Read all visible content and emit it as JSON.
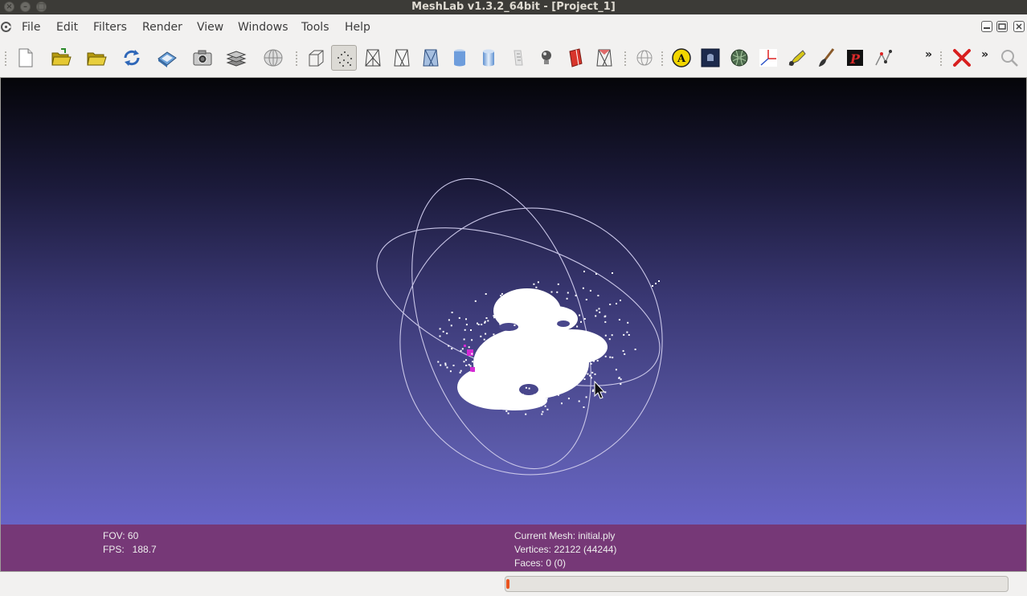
{
  "window": {
    "title": "MeshLab v1.3.2_64bit - [Project_1]"
  },
  "menubar": {
    "items": [
      {
        "label": "File"
      },
      {
        "label": "Edit"
      },
      {
        "label": "Filters"
      },
      {
        "label": "Render"
      },
      {
        "label": "View"
      },
      {
        "label": "Windows"
      },
      {
        "label": "Tools"
      },
      {
        "label": "Help"
      }
    ]
  },
  "toolbar": {
    "buttons": [
      {
        "icon": "new-document-icon"
      },
      {
        "icon": "open-project-icon"
      },
      {
        "icon": "import-mesh-icon"
      },
      {
        "icon": "reload-icon"
      },
      {
        "icon": "save-snapshot-icon"
      },
      {
        "icon": "camera-icon"
      },
      {
        "icon": "layers-icon"
      },
      {
        "icon": "raster-icon"
      },
      {
        "icon": "bounding-box-icon"
      },
      {
        "icon": "points-icon",
        "active": true
      },
      {
        "icon": "wireframe-icon"
      },
      {
        "icon": "hidden-lines-icon"
      },
      {
        "icon": "flat-lines-icon"
      },
      {
        "icon": "flat-shading-icon"
      },
      {
        "icon": "smooth-shading-icon"
      },
      {
        "icon": "texture-icon"
      },
      {
        "icon": "light-icon"
      },
      {
        "icon": "backface-icon"
      },
      {
        "icon": "selected-faces-icon"
      },
      {
        "icon": "trackball-icon"
      },
      {
        "icon": "annotation-icon"
      },
      {
        "icon": "raster-layer-icon"
      },
      {
        "icon": "texture-map-icon"
      },
      {
        "icon": "measure-icon"
      },
      {
        "icon": "pick-points-icon"
      },
      {
        "icon": "paint-brush-icon"
      },
      {
        "icon": "pdf-icon"
      },
      {
        "icon": "align-icon"
      },
      {
        "icon": "delete-icon"
      },
      {
        "icon": "search-icon"
      }
    ]
  },
  "info": {
    "fov": "FOV: 60",
    "fps": "FPS:   188.7",
    "current_mesh": "Current Mesh: initial.ply",
    "vertices": "Vertices: 22122 (44244)",
    "faces": "Faces: 0 (0)"
  },
  "status": {
    "progress": 0.005
  },
  "colors": {
    "info_panel": "#763877",
    "accent": "#e95420"
  }
}
